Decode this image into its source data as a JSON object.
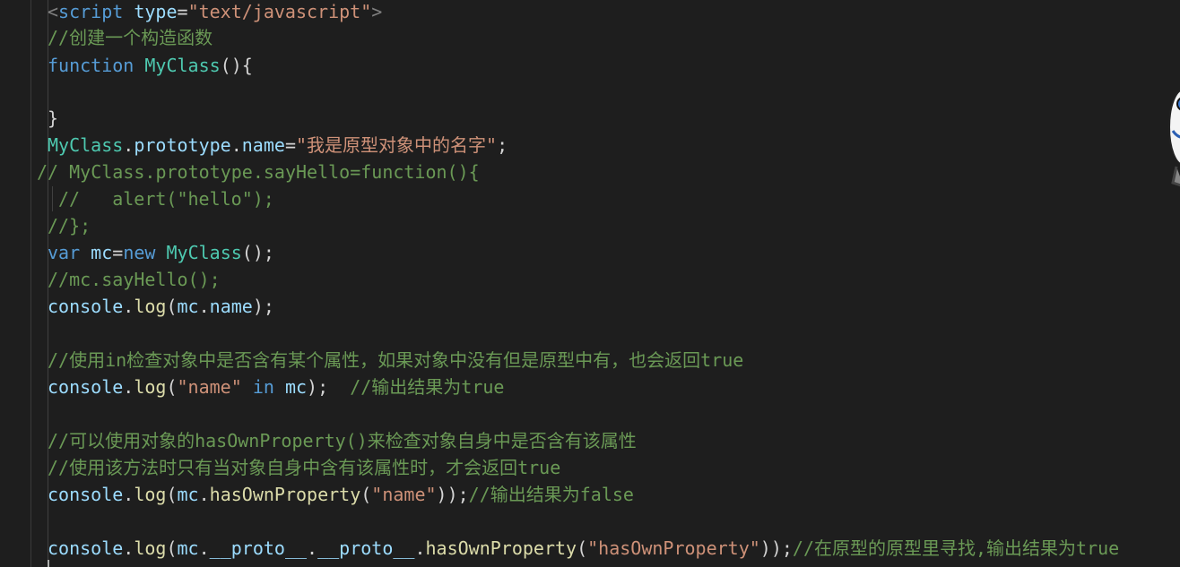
{
  "editor": {
    "theme_colors": {
      "background": "#1e1e1e",
      "comment": "#6a9955",
      "keyword": "#569cd6",
      "string": "#ce9178",
      "class": "#4ec9b0",
      "property": "#9cdcfe",
      "function": "#dcdcaa",
      "text": "#d4d4d4"
    },
    "lines": [
      {
        "tokens": [
          {
            "t": "<",
            "c": "tag"
          },
          {
            "t": "script",
            "c": "tagname"
          },
          {
            "t": " ",
            "c": "punct"
          },
          {
            "t": "type",
            "c": "attr"
          },
          {
            "t": "=",
            "c": "punct"
          },
          {
            "t": "\"text/javascript\"",
            "c": "string"
          },
          {
            "t": ">",
            "c": "tag"
          }
        ]
      },
      {
        "tokens": [
          {
            "t": "//创建一个构造函数",
            "c": "comment"
          }
        ]
      },
      {
        "tokens": [
          {
            "t": "function",
            "c": "keyword"
          },
          {
            "t": " ",
            "c": "punct"
          },
          {
            "t": "MyClass",
            "c": "cls"
          },
          {
            "t": "(){",
            "c": "punct"
          }
        ]
      },
      {
        "tokens": []
      },
      {
        "tokens": [
          {
            "t": "}",
            "c": "punct"
          }
        ]
      },
      {
        "tokens": [
          {
            "t": "MyClass",
            "c": "cls"
          },
          {
            "t": ".",
            "c": "punct"
          },
          {
            "t": "prototype",
            "c": "prop"
          },
          {
            "t": ".",
            "c": "punct"
          },
          {
            "t": "name",
            "c": "prop"
          },
          {
            "t": "=",
            "c": "punct"
          },
          {
            "t": "\"我是原型对象中的名字\"",
            "c": "string"
          },
          {
            "t": ";",
            "c": "punct"
          }
        ]
      },
      {
        "tokens": [
          {
            "t": "// MyClass.prototype.sayHello=function(){",
            "c": "comment"
          }
        ]
      },
      {
        "tokens": [
          {
            "t": "//   alert(\"hello\");",
            "c": "comment"
          }
        ]
      },
      {
        "tokens": [
          {
            "t": "//};",
            "c": "comment"
          }
        ]
      },
      {
        "tokens": [
          {
            "t": "var",
            "c": "keyword"
          },
          {
            "t": " ",
            "c": "punct"
          },
          {
            "t": "mc",
            "c": "prop"
          },
          {
            "t": "=",
            "c": "punct"
          },
          {
            "t": "new",
            "c": "keyword"
          },
          {
            "t": " ",
            "c": "punct"
          },
          {
            "t": "MyClass",
            "c": "cls"
          },
          {
            "t": "();",
            "c": "punct"
          }
        ]
      },
      {
        "tokens": [
          {
            "t": "//mc.sayHello();",
            "c": "comment"
          }
        ]
      },
      {
        "tokens": [
          {
            "t": "console",
            "c": "prop"
          },
          {
            "t": ".",
            "c": "punct"
          },
          {
            "t": "log",
            "c": "func"
          },
          {
            "t": "(",
            "c": "punct"
          },
          {
            "t": "mc",
            "c": "prop"
          },
          {
            "t": ".",
            "c": "punct"
          },
          {
            "t": "name",
            "c": "prop"
          },
          {
            "t": ");",
            "c": "punct"
          }
        ]
      },
      {
        "tokens": []
      },
      {
        "tokens": [
          {
            "t": "//使用in检查对象中是否含有某个属性，如果对象中没有但是原型中有，也会返回true",
            "c": "comment"
          }
        ]
      },
      {
        "tokens": [
          {
            "t": "console",
            "c": "prop"
          },
          {
            "t": ".",
            "c": "punct"
          },
          {
            "t": "log",
            "c": "func"
          },
          {
            "t": "(",
            "c": "punct"
          },
          {
            "t": "\"name\"",
            "c": "string"
          },
          {
            "t": " ",
            "c": "punct"
          },
          {
            "t": "in",
            "c": "keyword"
          },
          {
            "t": " ",
            "c": "punct"
          },
          {
            "t": "mc",
            "c": "prop"
          },
          {
            "t": ");  ",
            "c": "punct"
          },
          {
            "t": "//输出结果为true",
            "c": "comment"
          }
        ]
      },
      {
        "tokens": []
      },
      {
        "tokens": [
          {
            "t": "//可以使用对象的hasOwnProperty()来检查对象自身中是否含有该属性",
            "c": "comment"
          }
        ]
      },
      {
        "tokens": [
          {
            "t": "//使用该方法时只有当对象自身中含有该属性时，才会返回true",
            "c": "comment"
          }
        ]
      },
      {
        "tokens": [
          {
            "t": "console",
            "c": "prop"
          },
          {
            "t": ".",
            "c": "punct"
          },
          {
            "t": "log",
            "c": "func"
          },
          {
            "t": "(",
            "c": "punct"
          },
          {
            "t": "mc",
            "c": "prop"
          },
          {
            "t": ".",
            "c": "punct"
          },
          {
            "t": "hasOwnProperty",
            "c": "func"
          },
          {
            "t": "(",
            "c": "punct"
          },
          {
            "t": "\"name\"",
            "c": "string"
          },
          {
            "t": "));",
            "c": "punct"
          },
          {
            "t": "//输出结果为false",
            "c": "comment"
          }
        ]
      },
      {
        "tokens": []
      },
      {
        "tokens": [
          {
            "t": "console",
            "c": "prop"
          },
          {
            "t": ".",
            "c": "punct"
          },
          {
            "t": "log",
            "c": "func"
          },
          {
            "t": "(",
            "c": "punct"
          },
          {
            "t": "mc",
            "c": "prop"
          },
          {
            "t": ".",
            "c": "punct"
          },
          {
            "t": "__proto__",
            "c": "prop"
          },
          {
            "t": ".",
            "c": "punct"
          },
          {
            "t": "__proto__",
            "c": "prop"
          },
          {
            "t": ".",
            "c": "punct"
          },
          {
            "t": "hasOwnProperty",
            "c": "func"
          },
          {
            "t": "(",
            "c": "punct"
          },
          {
            "t": "\"hasOwnProperty\"",
            "c": "string"
          },
          {
            "t": "));",
            "c": "punct"
          },
          {
            "t": "//在原型的原型里寻找,输出结果为true",
            "c": "comment"
          }
        ]
      }
    ]
  },
  "mascot": {
    "icon": "mascot-figure-icon"
  }
}
